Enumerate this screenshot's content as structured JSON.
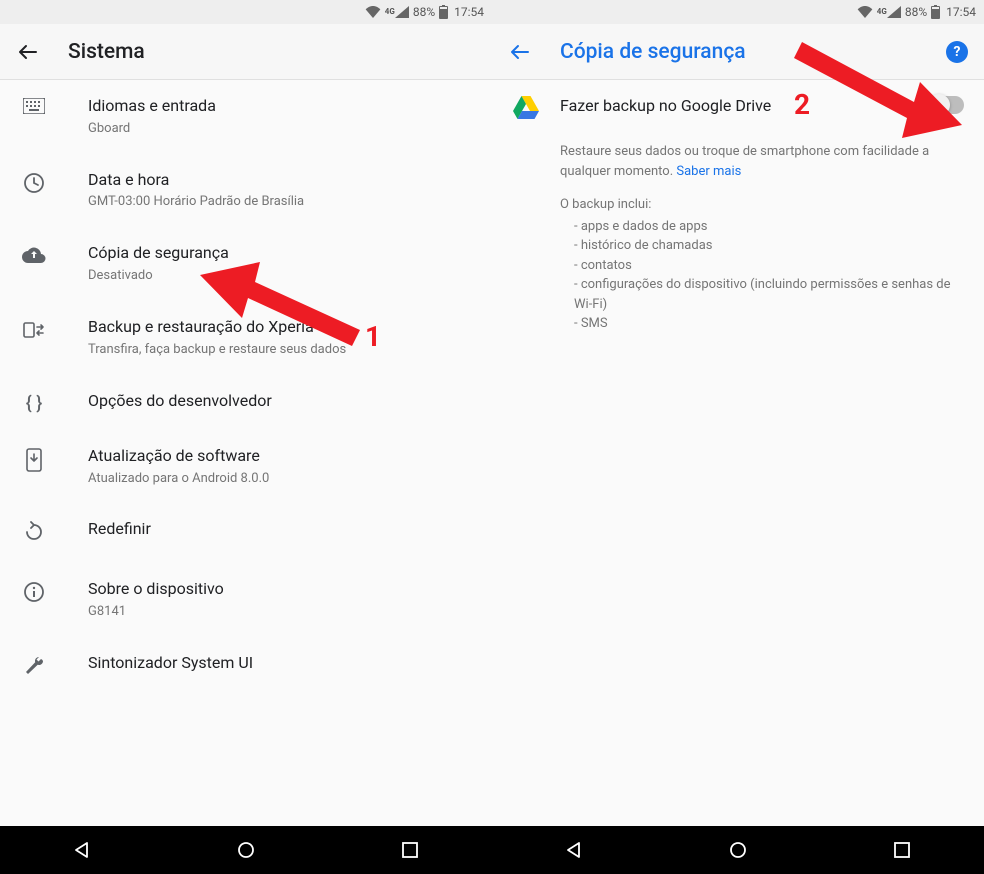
{
  "status": {
    "battery_pct": "88%",
    "time": "17:54",
    "signal_label": "4G"
  },
  "left": {
    "title": "Sistema",
    "items": [
      {
        "label": "Idiomas e entrada",
        "sub": "Gboard"
      },
      {
        "label": "Data e hora",
        "sub": "GMT-03:00 Horário Padrão de Brasília"
      },
      {
        "label": "Cópia de segurança",
        "sub": "Desativado"
      },
      {
        "label": "Backup e restauração do Xperia™",
        "sub": "Transfira, faça backup e restaure seus dados"
      },
      {
        "label": "Opções do desenvolvedor",
        "sub": ""
      },
      {
        "label": "Atualização de software",
        "sub": "Atualizado para o Android 8.0.0"
      },
      {
        "label": "Redefinir",
        "sub": ""
      },
      {
        "label": "Sobre o dispositivo",
        "sub": "G8141"
      },
      {
        "label": "Sintonizador System UI",
        "sub": ""
      }
    ]
  },
  "right": {
    "title": "Cópia de segurança",
    "toggle_label": "Fazer backup no Google Drive",
    "toggle_on": false,
    "desc_line1": "Restaure seus dados ou troque de smartphone com facilidade a qualquer momento. ",
    "learn_more": "Saber mais",
    "includes_title": "O backup inclui:",
    "bullets": [
      "apps e dados de apps",
      "histórico de chamadas",
      "contatos",
      "configurações do dispositivo (incluindo permissões e senhas de Wi-Fi)",
      "SMS"
    ]
  },
  "annotations": {
    "label1": "1",
    "label2": "2"
  }
}
